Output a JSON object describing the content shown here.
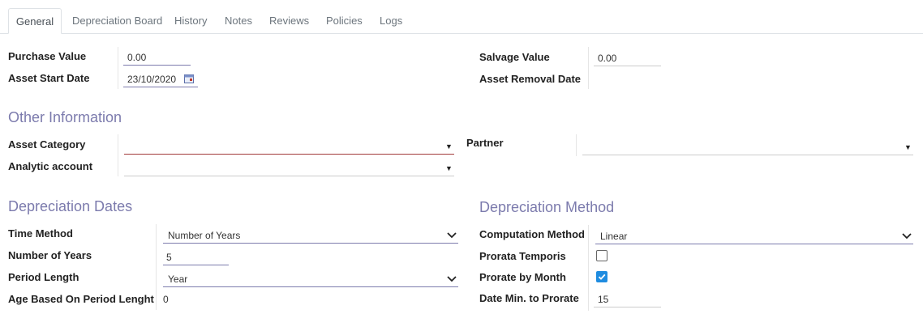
{
  "tabs": [
    "General",
    "Depreciation Board",
    "History",
    "Notes",
    "Reviews",
    "Policies",
    "Logs"
  ],
  "top_left": {
    "purchase_value_label": "Purchase Value",
    "purchase_value": "0.00",
    "asset_start_date_label": "Asset Start Date",
    "asset_start_date": "23/10/2020"
  },
  "top_right": {
    "salvage_value_label": "Salvage Value",
    "salvage_value": "0.00",
    "asset_removal_date_label": "Asset Removal Date"
  },
  "other_info": {
    "title": "Other Information",
    "asset_category_label": "Asset Category",
    "analytic_account_label": "Analytic account",
    "partner_label": "Partner"
  },
  "dep_dates": {
    "title": "Depreciation Dates",
    "time_method_label": "Time Method",
    "time_method": "Number of Years",
    "number_of_years_label": "Number of Years",
    "number_of_years": "5",
    "period_length_label": "Period Length",
    "period_length": "Year",
    "age_label": "Age Based On Period Lenght",
    "age_value": "0"
  },
  "dep_method": {
    "title": "Depreciation Method",
    "computation_method_label": "Computation Method",
    "computation_method": "Linear",
    "prorata_temporis_label": "Prorata Temporis",
    "prorata_temporis_checked": false,
    "prorate_by_month_label": "Prorate by Month",
    "prorate_by_month_checked": true,
    "date_min_label": "Date Min. to Prorate",
    "date_min_value": "15"
  },
  "colors": {
    "accent": "#7c7bad",
    "checkbox_checked": "#1f8ce0",
    "required_border": "#a23b3b"
  }
}
